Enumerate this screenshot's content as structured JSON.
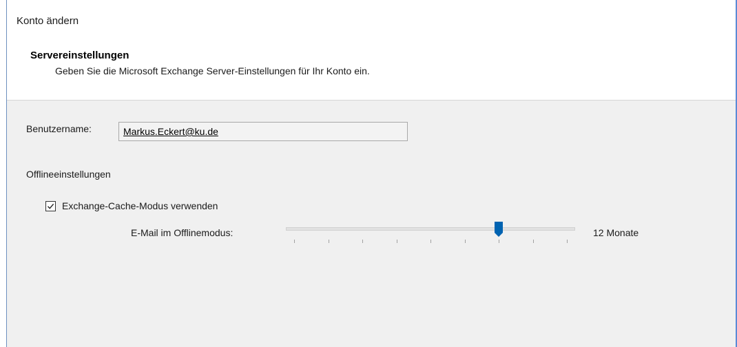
{
  "window": {
    "title": "Konto ändern"
  },
  "header": {
    "section_title": "Servereinstellungen",
    "section_subtitle": "Geben Sie die Microsoft Exchange Server-Einstellungen für Ihr Konto ein."
  },
  "form": {
    "username_label": "Benutzername:",
    "username_value": "Markus.Eckert@ku.de",
    "offline_heading": "Offlineeinstellungen",
    "cache_mode_label": "Exchange-Cache-Modus verwenden",
    "cache_mode_checked": true,
    "offline_mail_label": "E-Mail im Offlinemodus:",
    "offline_mail_value": "12 Monate",
    "slider": {
      "tick_count": 9,
      "selected_index": 6,
      "thumb_color": "#0063b1"
    }
  },
  "icons": {
    "checkbox": "checkmark-icon",
    "slider_thumb": "slider-thumb-icon"
  }
}
